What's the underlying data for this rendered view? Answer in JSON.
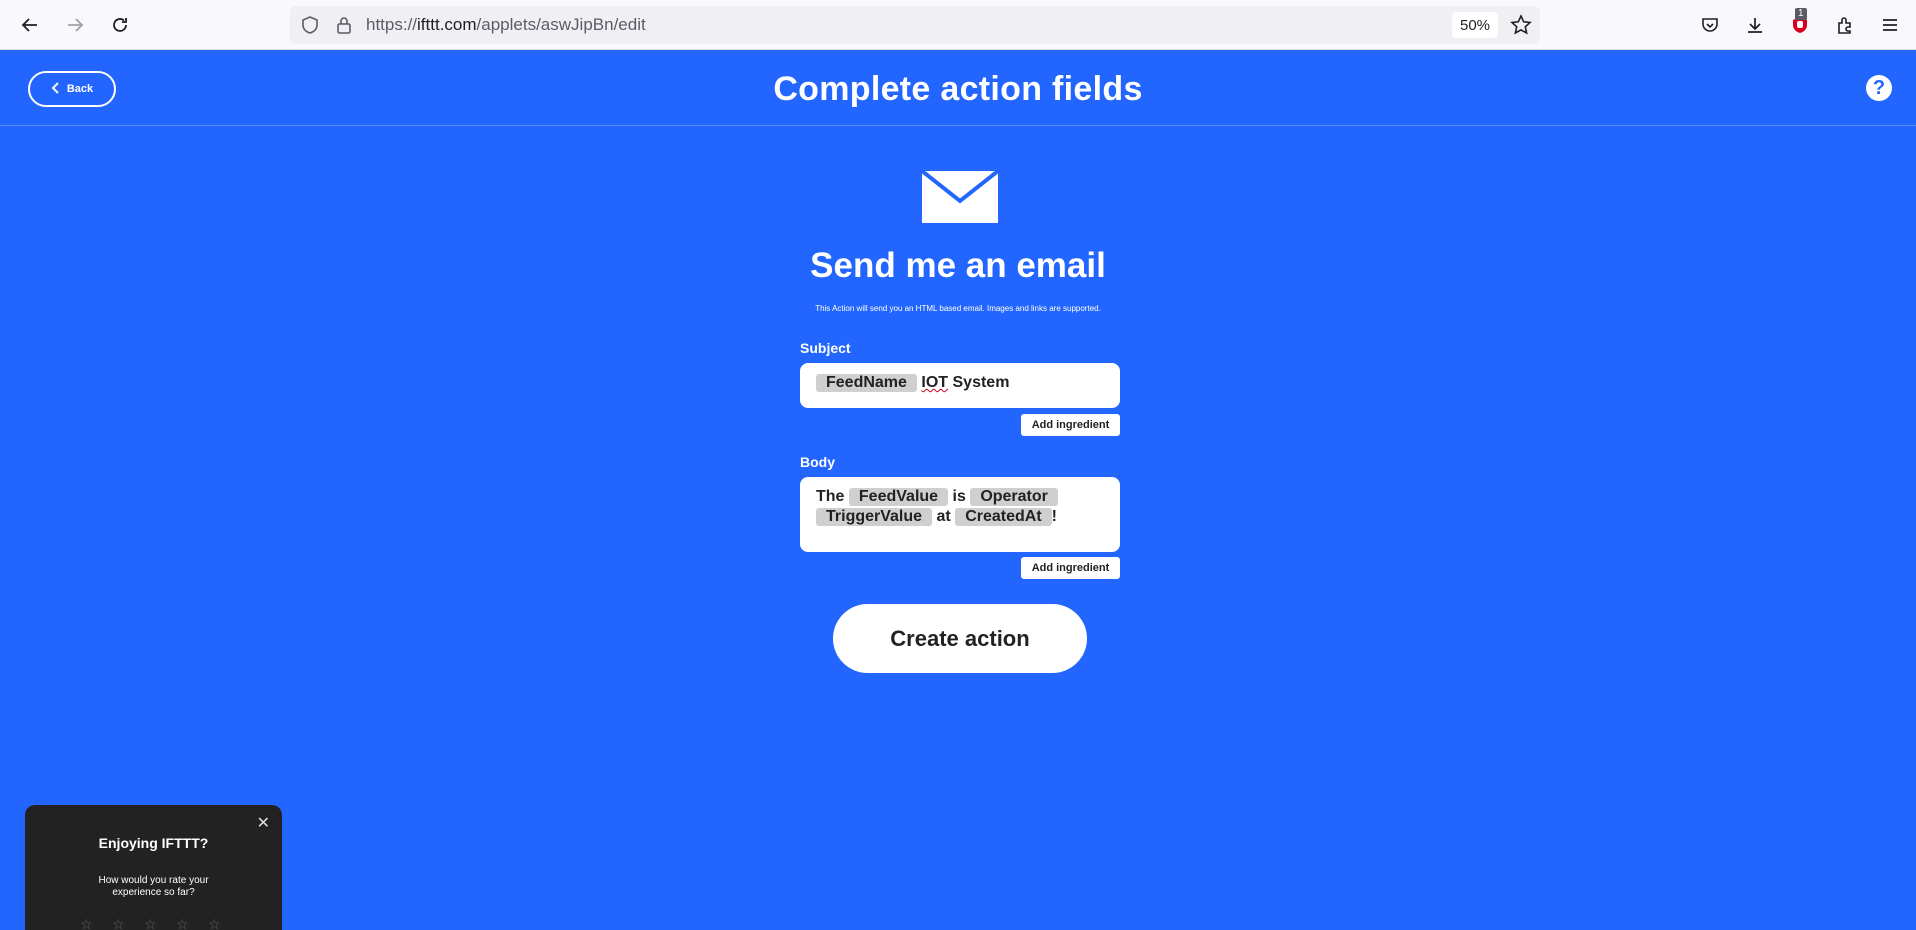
{
  "browser": {
    "url_prefix": "https://",
    "url_host": "ifttt.com",
    "url_path": "/applets/aswJipBn/edit",
    "zoom": "50%",
    "ublock_count": "1"
  },
  "header": {
    "back_label": "Back",
    "title": "Complete action fields",
    "help_glyph": "?"
  },
  "action": {
    "icon": "envelope-icon",
    "title": "Send me an email",
    "description": "This Action will send you an HTML based email. Images and links are supported."
  },
  "subject": {
    "label": "Subject",
    "ingredient": "FeedName",
    "text_word1": "IOT",
    "text_word2": " System",
    "add_label": "Add ingredient"
  },
  "body": {
    "label": "Body",
    "t1": "The",
    "i1": "FeedValue",
    "t2": "is",
    "i2": "Operator",
    "i3": "TriggerValue",
    "t3": "at",
    "i4": "CreatedAt",
    "t4": "!",
    "add_label": "Add ingredient"
  },
  "create_label": "Create action",
  "feedback": {
    "close_glyph": "✕",
    "title": "Enjoying IFTTT?",
    "question": "How would you rate your experience so far?"
  },
  "colors": {
    "brand_blue": "#2266ff",
    "white": "#ffffff",
    "popup_bg": "#222222"
  }
}
